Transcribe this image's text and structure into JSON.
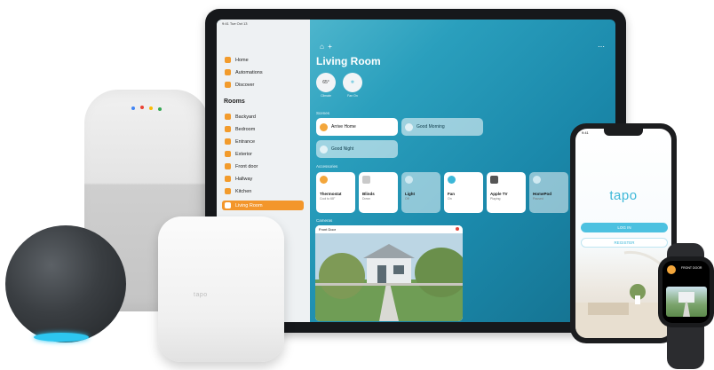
{
  "ipad": {
    "status_time": "9:41 Tue Oct 13",
    "sidebar": {
      "top_items": [
        "Home",
        "Automations",
        "Discover"
      ],
      "rooms_heading": "Rooms",
      "rooms": [
        "Backyard",
        "Bedroom",
        "Entrance",
        "Exterior",
        "Front door",
        "Hallway",
        "Kitchen",
        "Living Room"
      ],
      "active_room": "Living Room"
    },
    "main": {
      "top_icons": [
        "home-icon",
        "plus-icon"
      ],
      "title": "Living Room",
      "status_bubbles": [
        {
          "value": "65°",
          "label": "Climate"
        },
        {
          "value": "❄",
          "label": "Fan On"
        }
      ],
      "scenes_label": "Scenes",
      "scenes": [
        {
          "name": "Arrive Home",
          "state": "on"
        },
        {
          "name": "Good Morning",
          "state": "off"
        },
        {
          "name": "Good Night",
          "state": "off"
        }
      ],
      "accessories_label": "Accessories",
      "accessories": [
        {
          "name": "Thermostat",
          "status": "Cool to 68°",
          "state": "on",
          "color": "#f3a63b"
        },
        {
          "name": "Blinds",
          "status": "Down",
          "state": "on",
          "color": "#c9c9c9"
        },
        {
          "name": "Light",
          "status": "Off",
          "state": "off",
          "color": "#cfe9f1"
        },
        {
          "name": "Fan",
          "status": "On",
          "state": "on",
          "color": "#3cb7d8"
        },
        {
          "name": "Apple TV",
          "status": "Playing",
          "state": "on",
          "color": "#555555"
        },
        {
          "name": "HomePod",
          "status": "Paused",
          "state": "off",
          "color": "#cfe9f1"
        }
      ],
      "cameras_label": "Cameras",
      "camera": {
        "name": "Front Door"
      }
    }
  },
  "iphone": {
    "time": "9:41",
    "app_logo": "tapo",
    "login_label": "LOG IN",
    "register_label": "REGISTER"
  },
  "watch": {
    "title": "FRONT DOOR"
  },
  "hub": {
    "logo": "tapo"
  },
  "colors": {
    "accent_orange": "#f3962b",
    "tapo_blue": "#3cb7d8",
    "echo_ring": "#2dc6f0"
  }
}
